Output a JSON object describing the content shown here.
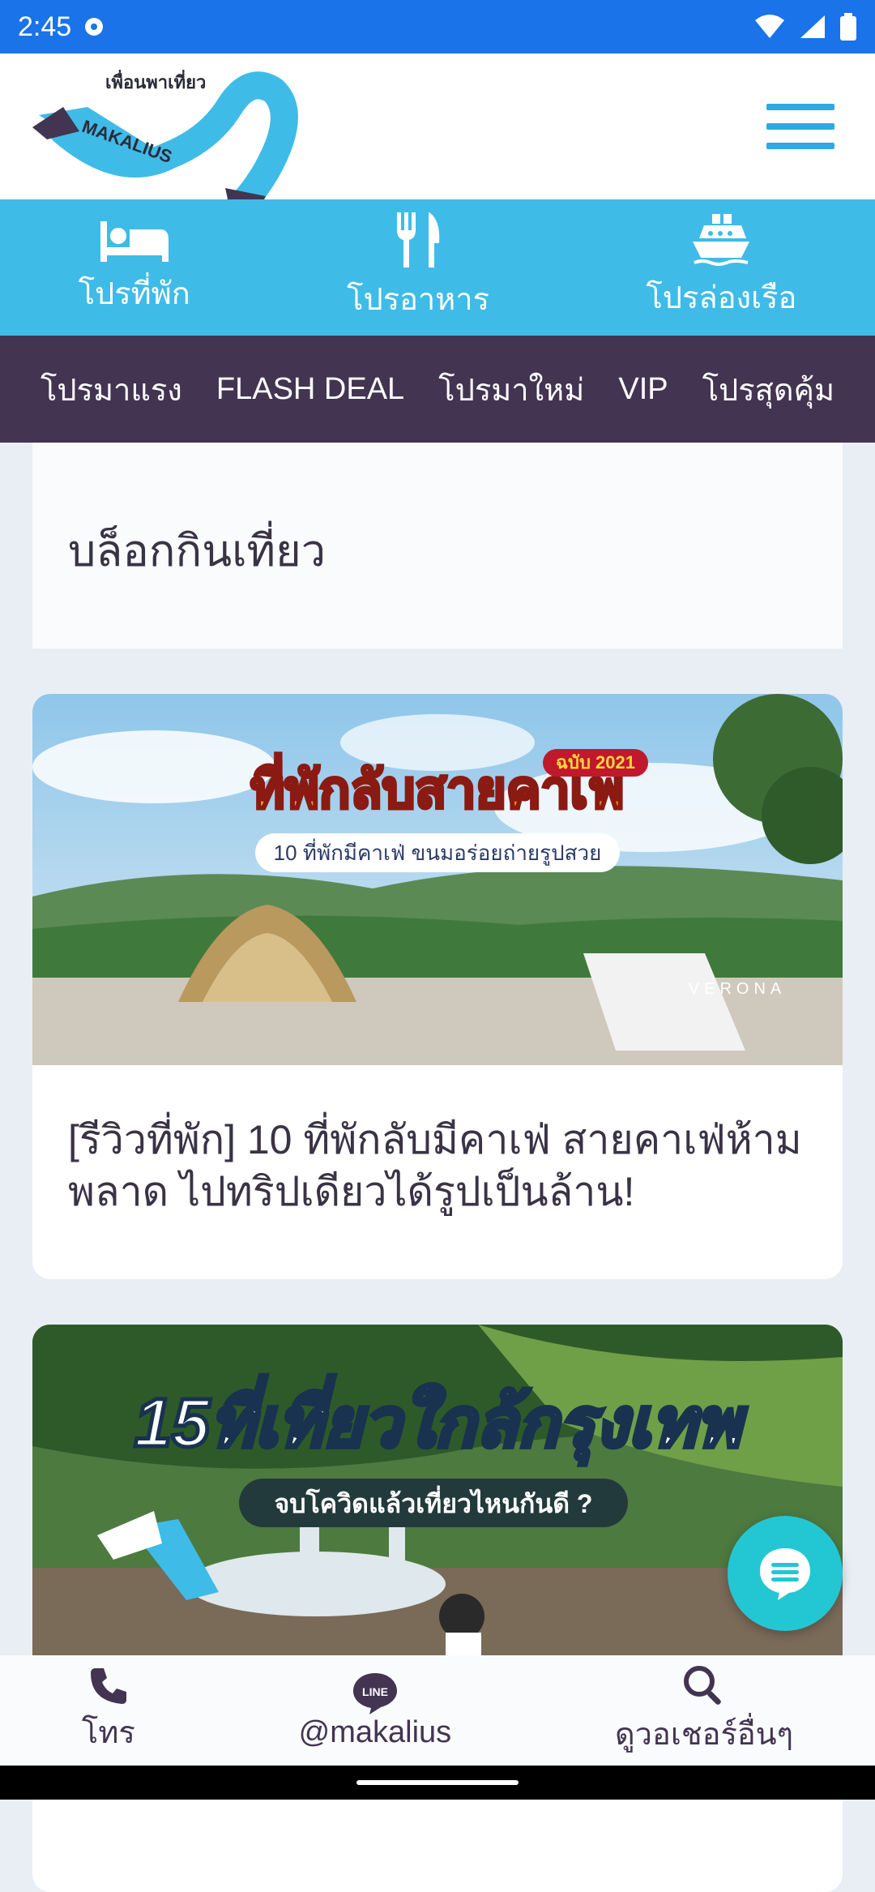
{
  "status": {
    "time": "2:45"
  },
  "header": {
    "logo_text": "เพื่อนพาเที่ยว",
    "logo_brand": "MAKALIUS"
  },
  "categories": [
    {
      "label": "โปรที่พัก",
      "icon": "bed-icon"
    },
    {
      "label": "โปรอาหาร",
      "icon": "utensils-icon"
    },
    {
      "label": "โปรล่องเรือ",
      "icon": "ship-icon"
    }
  ],
  "deals_nav": [
    "โปรมาแรง",
    "FLASH DEAL",
    "โปรมาใหม่",
    "VIP",
    "โปรสุดคุ้ม"
  ],
  "blog": {
    "title": "บล็อกกินเที่ยว"
  },
  "articles": [
    {
      "banner_title": "ที่พักลับสายคาเฟ่",
      "banner_sub": "10 ที่พักมีคาเฟ่ ขนมอร่อยถ่ายรูปสวย",
      "badge": "ฉบับ 2021",
      "sign": "VERONA",
      "caption": "[รีวิวที่พัก] 10 ที่พักลับมีคาเฟ่ สายคาเฟ่ห้ามพลาด ไปทริปเดียวได้รูปเป็นล้าน!"
    },
    {
      "banner_title": "15ที่เที่ยวใกล้กรุงเทพ",
      "banner_sub": "จบโควิดแล้วเที่ยวไหนกันดี ?"
    }
  ],
  "bottom_bar": [
    {
      "label": "โทร",
      "icon": "phone-icon"
    },
    {
      "label": "@makalius",
      "icon": "line-icon",
      "icon_text": "LINE"
    },
    {
      "label": "ดูวอเชอร์อื่นๆ",
      "icon": "search-icon"
    }
  ],
  "colors": {
    "status_bar": "#1a73e8",
    "category_bar": "#3fbbe8",
    "deals_bar": "#433452",
    "fab": "#23c7d4"
  }
}
